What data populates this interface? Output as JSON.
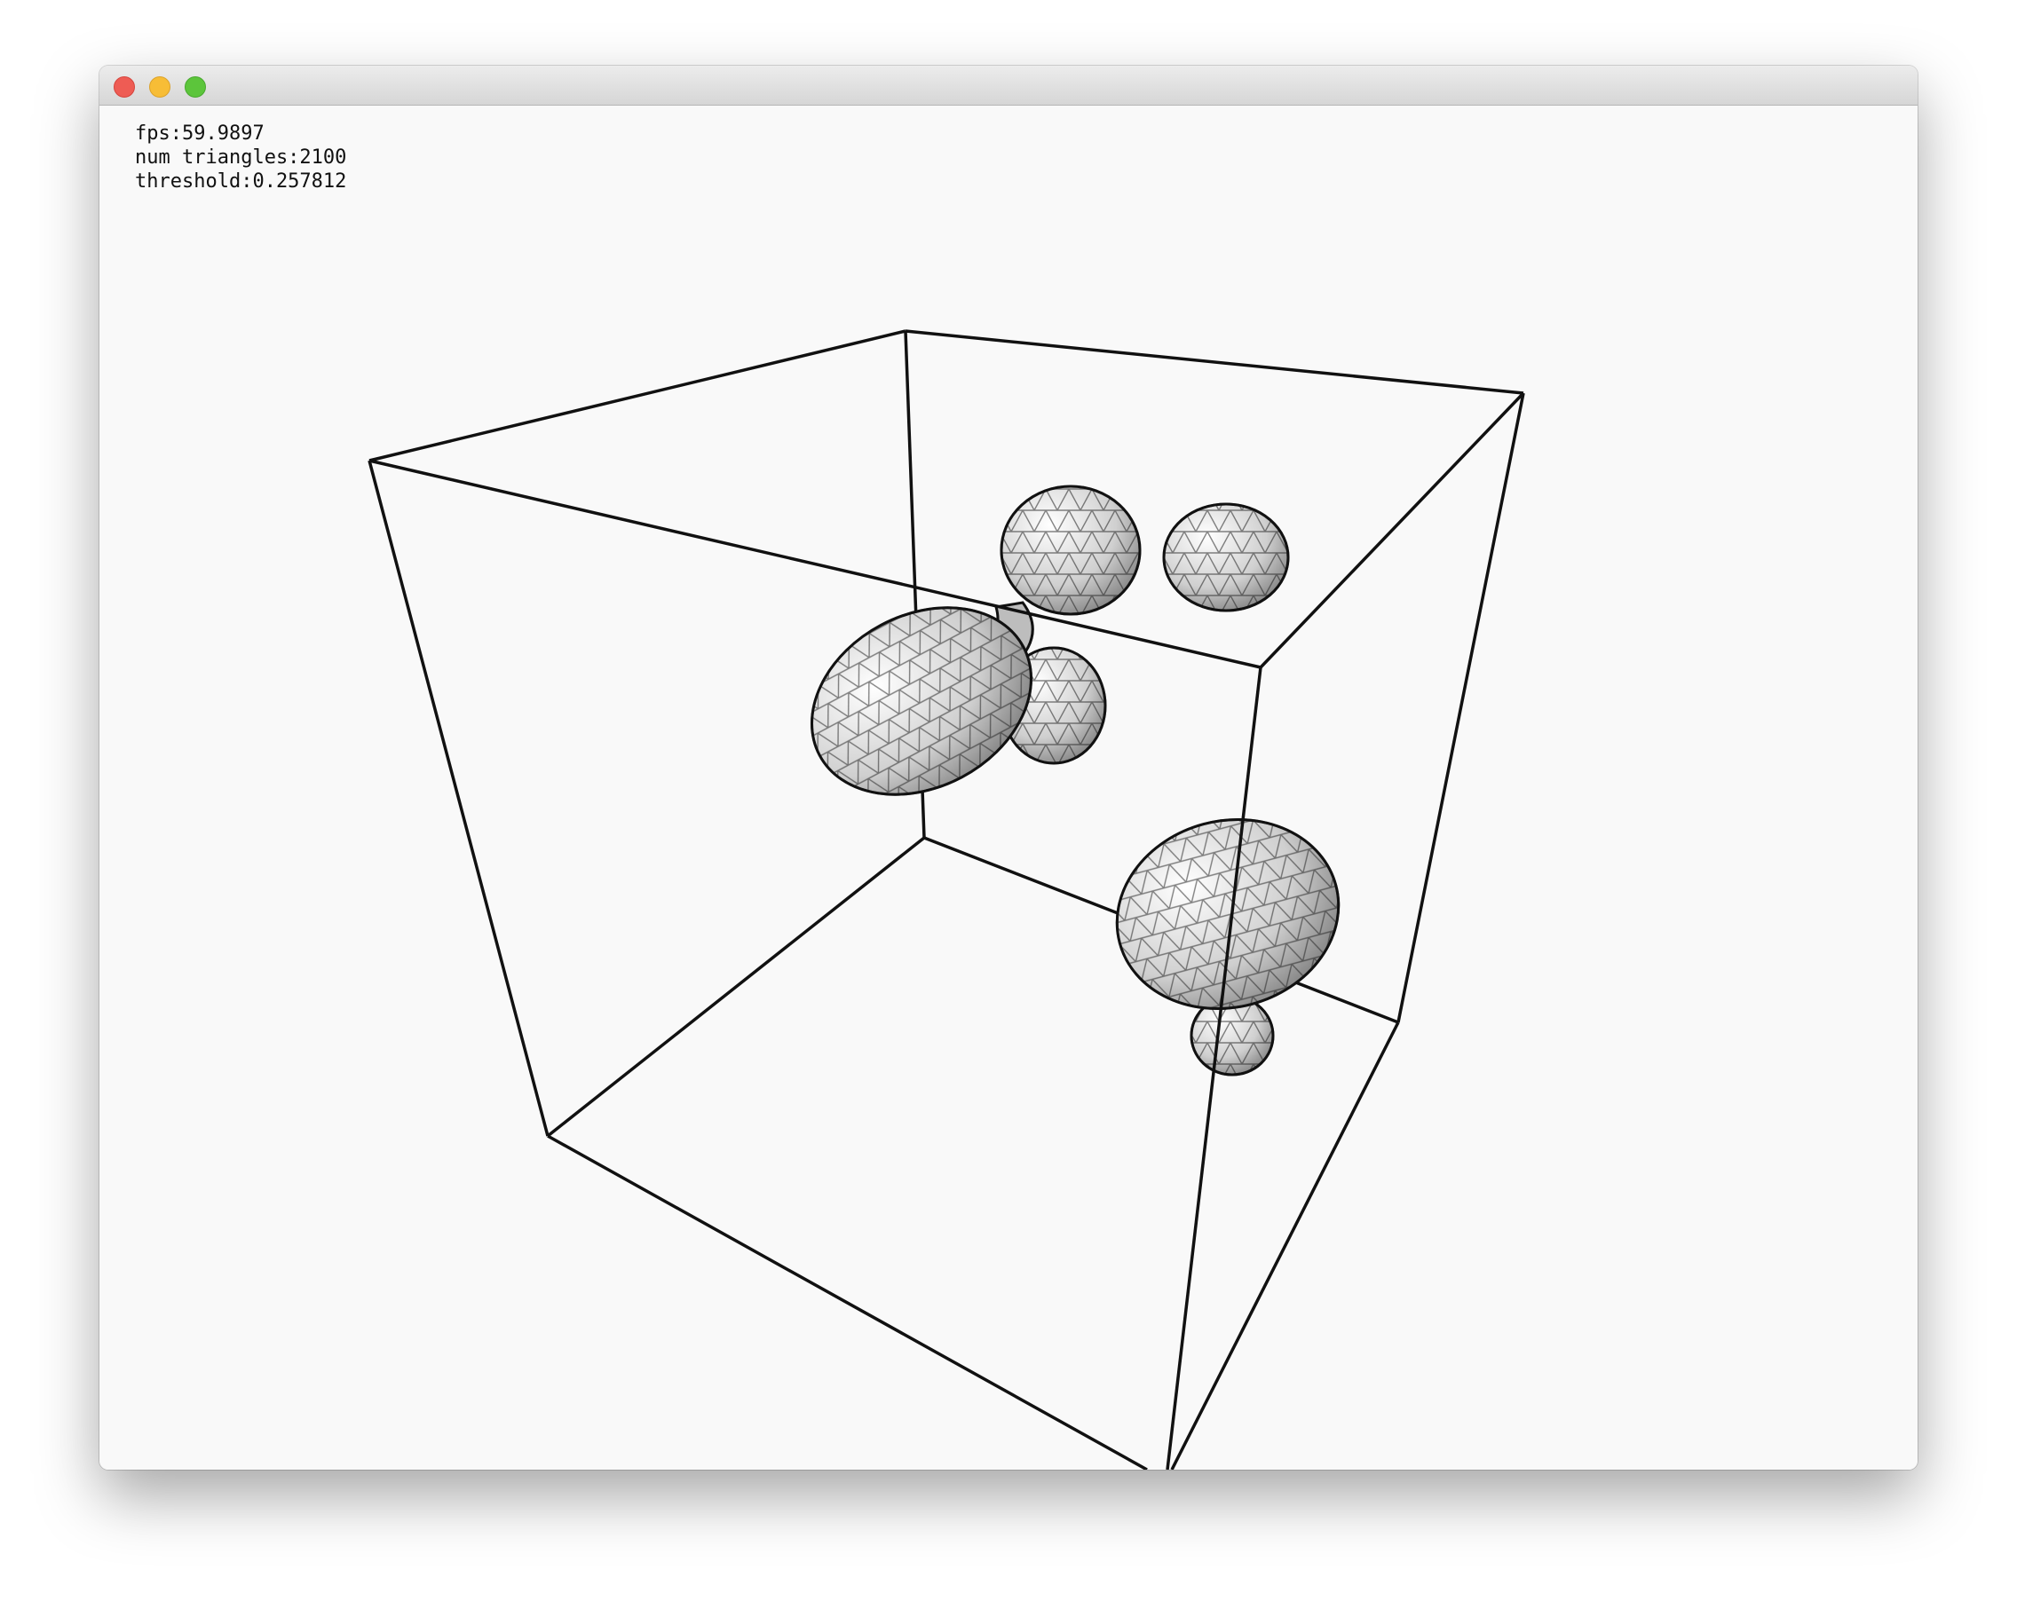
{
  "window": {
    "title": "",
    "controls": {
      "close": {
        "icon": "close-dot-icon",
        "color": "#ee5c54"
      },
      "minimize": {
        "icon": "minimize-dot-icon",
        "color": "#f7bd36"
      },
      "zoom": {
        "icon": "zoom-dot-icon",
        "color": "#5cc53b"
      }
    }
  },
  "hud": {
    "fps": "fps:59.9897",
    "triangles": "num triangles:2100",
    "threshold": "threshold:0.257812"
  },
  "scene": {
    "background_color": "#f9f9f9",
    "edge_color": "#111111",
    "blob_color": "#c9c9c9"
  }
}
